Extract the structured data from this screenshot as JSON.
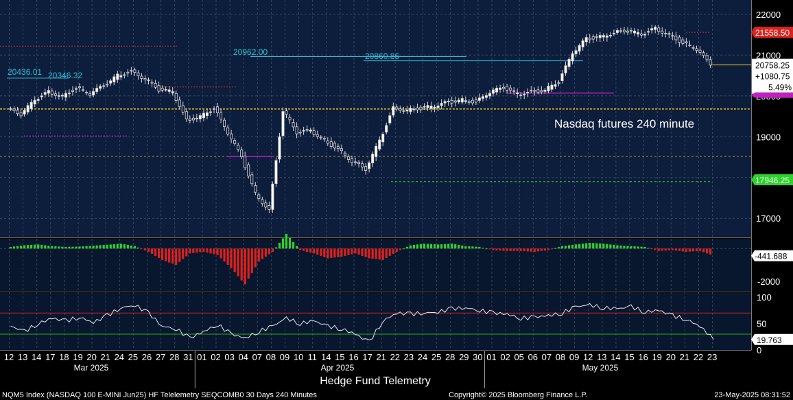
{
  "chart_data": [
    {
      "panel": "price",
      "type": "candlestick",
      "annotation": "Nasdaq futures 240 minute",
      "ylim": [
        16550,
        22350
      ],
      "y_ticks": [
        "17000",
        "18000",
        "19000",
        "20000",
        "21000",
        "22000"
      ],
      "last_price": {
        "value": 20758.25,
        "label": "20758.25",
        "change": "+1080.75",
        "change_pct": "5.49%"
      },
      "price_tags": [
        {
          "value": 21558.5,
          "label": "21558.50",
          "color": "#e0201c"
        },
        {
          "value": 17946.25,
          "label": "17946.25",
          "color": "#2bd42b"
        }
      ],
      "level_labels": [
        {
          "text": "20436.01",
          "value": 20436.01
        },
        {
          "text": "20346.32",
          "value": 20346.32
        },
        {
          "text": "20962.00",
          "value": 20962.0
        },
        {
          "text": "20860.86",
          "value": 20860.86
        }
      ],
      "dates": [
        "12",
        "13",
        "14",
        "17",
        "18",
        "19",
        "20",
        "21",
        "24",
        "25",
        "26",
        "27",
        "28",
        "31",
        "01",
        "02",
        "03",
        "04",
        "07",
        "08",
        "09",
        "10",
        "11",
        "14",
        "15",
        "16",
        "17",
        "21",
        "22",
        "23",
        "24",
        "25",
        "28",
        "29",
        "30",
        "01",
        "02",
        "05",
        "06",
        "07",
        "08",
        "09",
        "12",
        "13",
        "14",
        "15",
        "16",
        "19",
        "20",
        "21",
        "22",
        "23"
      ],
      "closes": [
        19680,
        19550,
        19900,
        20100,
        19990,
        20200,
        20050,
        20250,
        20500,
        20600,
        20420,
        20150,
        20100,
        19400,
        19500,
        19700,
        19100,
        18500,
        17600,
        17200,
        19650,
        19100,
        19150,
        18900,
        18700,
        18400,
        18200,
        18900,
        19700,
        19650,
        19700,
        19750,
        19850,
        19900,
        19850,
        20100,
        20200,
        20050,
        20100,
        20150,
        20350,
        21050,
        21400,
        21450,
        21550,
        21600,
        21500,
        21650,
        21500,
        21300,
        21150,
        20758.25
      ]
    },
    {
      "panel": "oscillator",
      "type": "bar",
      "last_value": "-441.688",
      "ylim": [
        -2600,
        600
      ],
      "y_ticks": [
        "-2000"
      ],
      "values": [
        100,
        200,
        250,
        150,
        100,
        120,
        180,
        230,
        300,
        150,
        -200,
        -700,
        -1000,
        -300,
        -200,
        -400,
        -1200,
        -2200,
        -800,
        -200,
        900,
        -100,
        -300,
        -600,
        -500,
        -300,
        -600,
        -700,
        -200,
        200,
        300,
        250,
        300,
        150,
        100,
        -100,
        -150,
        -150,
        -200,
        -100,
        150,
        250,
        350,
        300,
        200,
        150,
        100,
        -150,
        -100,
        -200,
        -150,
        -441.688
      ]
    },
    {
      "panel": "rsi",
      "type": "line",
      "last_value": "19.763",
      "ylim": [
        0,
        108
      ],
      "y_ticks": [
        "100",
        "50",
        "0"
      ],
      "upper_band": 70,
      "lower_band": 30,
      "values": [
        45,
        35,
        50,
        60,
        55,
        62,
        52,
        65,
        80,
        85,
        70,
        45,
        40,
        22,
        35,
        48,
        30,
        22,
        35,
        45,
        60,
        50,
        55,
        45,
        40,
        30,
        15,
        55,
        70,
        68,
        70,
        72,
        78,
        80,
        75,
        70,
        68,
        60,
        62,
        65,
        70,
        82,
        85,
        80,
        78,
        82,
        72,
        75,
        65,
        58,
        45,
        19.763
      ]
    }
  ],
  "axis": {
    "months": [
      "Mar 2025",
      "Apr 2025",
      "May 2025"
    ]
  },
  "title": "Hedge Fund Telemetry",
  "footer": {
    "left": "NQM5 Index (NASDAQ 100 E-MINI Jun25) HF Telelemetry SEQCOMB0 30 Days 240 Minutes",
    "center": "Copyright© 2025 Bloomberg Finance L.P.",
    "right": "23-May-2025 08:31:52"
  },
  "colors": {
    "price_bg": "#0d1d3c",
    "osc_bg": "#08162e",
    "up_bar": "#2bd42b",
    "down_bar": "#e0201c",
    "magenta": "#c020c0",
    "cyan": "#29c4d8",
    "yellow": "#e8c020"
  }
}
